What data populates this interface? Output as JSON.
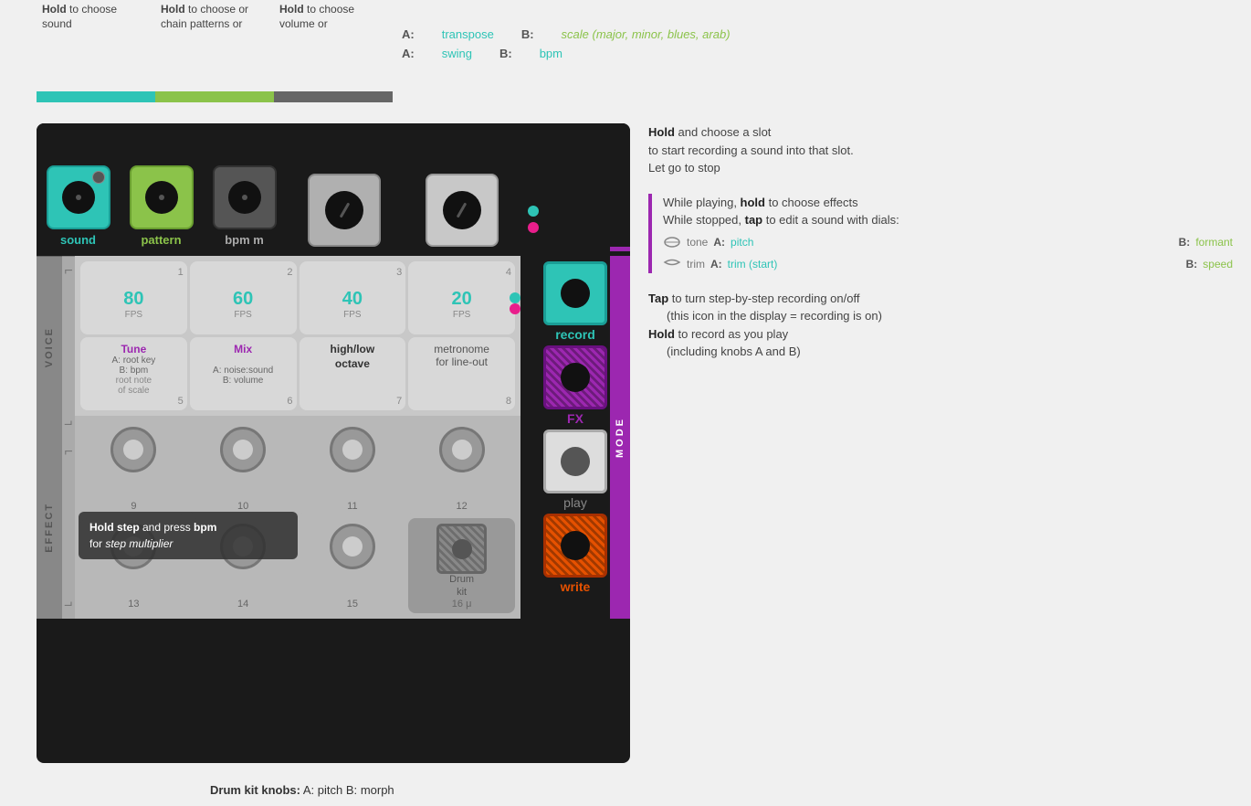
{
  "header": {
    "col1": {
      "text": "Hold to choose sound",
      "bar": "teal"
    },
    "col2": {
      "text": "Hold to choose or chain patterns or",
      "bar": "green"
    },
    "col3": {
      "text": "Hold to choose volume or",
      "bar": "darkgray"
    },
    "ab_row1": {
      "a_label": "A:",
      "a_val": "transpose",
      "b_label": "B:",
      "b_val": "scale (major, minor, blues, arab)"
    },
    "ab_row2": {
      "a_label": "A:",
      "a_val": "swing",
      "b_label": "B:",
      "b_val": "bpm"
    }
  },
  "device": {
    "knob1_label": "sound",
    "knob2_label": "pattern",
    "knob3_label": "bpm m",
    "voice_label": "VOICE",
    "effect_label": "EFFECT",
    "mode_label": "MODE",
    "pads": [
      {
        "number": "1",
        "fps": "80",
        "fps_unit": "FPS"
      },
      {
        "number": "2",
        "fps": "60",
        "fps_unit": "FPS"
      },
      {
        "number": "3",
        "fps": "40",
        "fps_unit": "FPS"
      },
      {
        "number": "4",
        "fps": "20",
        "fps_unit": "FPS"
      },
      {
        "number": "5",
        "title": "Tune",
        "sub1": "A: root key",
        "sub2": "B: bpm",
        "sub3": "root note",
        "sub4": "of scale"
      },
      {
        "number": "6",
        "title": "Mix",
        "sub1": "A: noise:sound",
        "sub2": "B: volume"
      },
      {
        "number": "7",
        "title": "high/low octave",
        "bold": true
      },
      {
        "number": "8",
        "title": "metronome",
        "sub1": "for line-out"
      }
    ],
    "effect_pads": [
      {
        "number": "9"
      },
      {
        "number": "10"
      },
      {
        "number": "11"
      },
      {
        "number": "12"
      },
      {
        "number": "13"
      },
      {
        "number": "14"
      },
      {
        "number": "15"
      },
      {
        "number": "16 μ",
        "special": "drum_kit"
      }
    ],
    "record_label": "record",
    "fx_label": "FX",
    "play_label": "play",
    "write_label": "write",
    "tooltip": {
      "text1": "Hold step and press bpm",
      "text2": "for step multiplier"
    },
    "drum_kit": {
      "label": "Drum kit"
    }
  },
  "right_panel": {
    "section1": {
      "line1_strong": "Hold",
      "line1_rest": " and choose a slot",
      "line2": "to start recording a sound into that slot.",
      "line3": "Let go to stop"
    },
    "section2": {
      "line1_intro": "While playing, ",
      "line1_strong": "hold",
      "line1_rest": " to choose effects",
      "line2_intro": "While stopped, ",
      "line2_strong": "tap",
      "line2_rest": " to edit a sound with dials:",
      "tone_label": "tone",
      "tone_a_label": "A:",
      "tone_a_val": "pitch",
      "tone_b_label": "B:",
      "tone_b_val": "formant",
      "trim_label": "trim",
      "trim_a_label": "A:",
      "trim_a_val": "trim (start)",
      "trim_b_label": "B:",
      "trim_b_val": "speed"
    },
    "section3": {
      "line1_strong": "Tap",
      "line1_rest": " to turn step-by-step recording on/off",
      "line2": "(this icon in the display = recording is on)",
      "line3_strong": "Hold",
      "line3_rest": " to record as you play",
      "line4": "(including knobs A and B)"
    },
    "footer": {
      "text": "Drum kit knobs:",
      "a_label": "A:",
      "a_val": "pitch",
      "b_label": "B:",
      "b_val": "morph"
    }
  }
}
